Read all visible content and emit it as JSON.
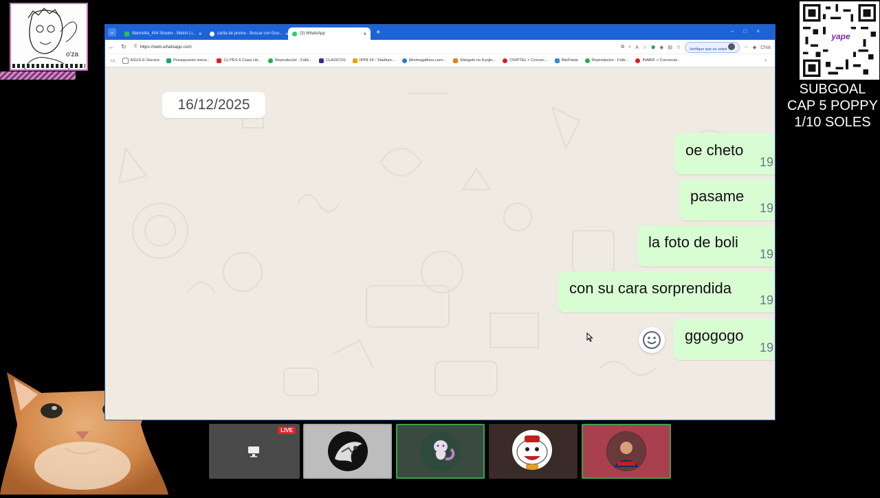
{
  "overlay": {
    "drawing_caption": "o'za",
    "subgoal": [
      "SUBGOAL",
      "CAP 5 POPPY",
      "1/10 SOLES"
    ],
    "qr_logo": "yape"
  },
  "browser": {
    "tabs": [
      {
        "label": "Mannotta_404 Stream - Watch Li...",
        "color": "#31c04a"
      },
      {
        "label": "carita de proma - Buscar con Goo...",
        "color": "#ffffff"
      },
      {
        "label": "(3) WhatsApp",
        "color": "#25d366"
      }
    ],
    "new_tab": "+",
    "url": "https://web.whatsapp.com",
    "verify_label": "Verifique que es usted",
    "chat_label": "Chat",
    "bookmarks": [
      {
        "label": "ASUS E-Service",
        "color": "#888888"
      },
      {
        "label": "Presupuesto mens...",
        "color": "#1ea362"
      },
      {
        "label": "(1) PES 6 Copa Lib...",
        "color": "#e02020"
      },
      {
        "label": "Reproductor - Fútb...",
        "color": "#2aa84a"
      },
      {
        "label": "CLASICOS",
        "color": "#3b2a8a"
      },
      {
        "label": "IPP8 24 - Stadium...",
        "color": "#f0a000"
      },
      {
        "label": "|Animegafines.com...",
        "color": "#2a7ad0"
      },
      {
        "label": "Shingeki no Kyojin...",
        "color": "#e08020"
      },
      {
        "label": "OSIPTEL > Convoc...",
        "color": "#d02020"
      },
      {
        "label": "BlizPaste",
        "color": "#3a8ad0"
      },
      {
        "label": "Reproductor - Fútb...",
        "color": "#2aa84a"
      },
      {
        "label": "INABIF > Convocat...",
        "color": "#d02020"
      }
    ]
  },
  "chat": {
    "date": "16/12/2025",
    "messages": [
      {
        "text": "oe cheto",
        "time": "19"
      },
      {
        "text": "pasame",
        "time": "19"
      },
      {
        "text": "la foto de boli",
        "time": "19"
      },
      {
        "text": "con su cara sorprendida",
        "time": "19"
      },
      {
        "text": "ggogogo",
        "time": "19"
      }
    ],
    "bubble_color": "#d9fdd3"
  },
  "strip": {
    "live_label": "LIVE",
    "tiles": [
      {
        "icon": "screen-share-icon"
      },
      {
        "icon": "dragon-avatar"
      },
      {
        "icon": "mewtwo-avatar"
      },
      {
        "icon": "cartoon-avatar"
      },
      {
        "icon": "person-avatar"
      }
    ]
  }
}
